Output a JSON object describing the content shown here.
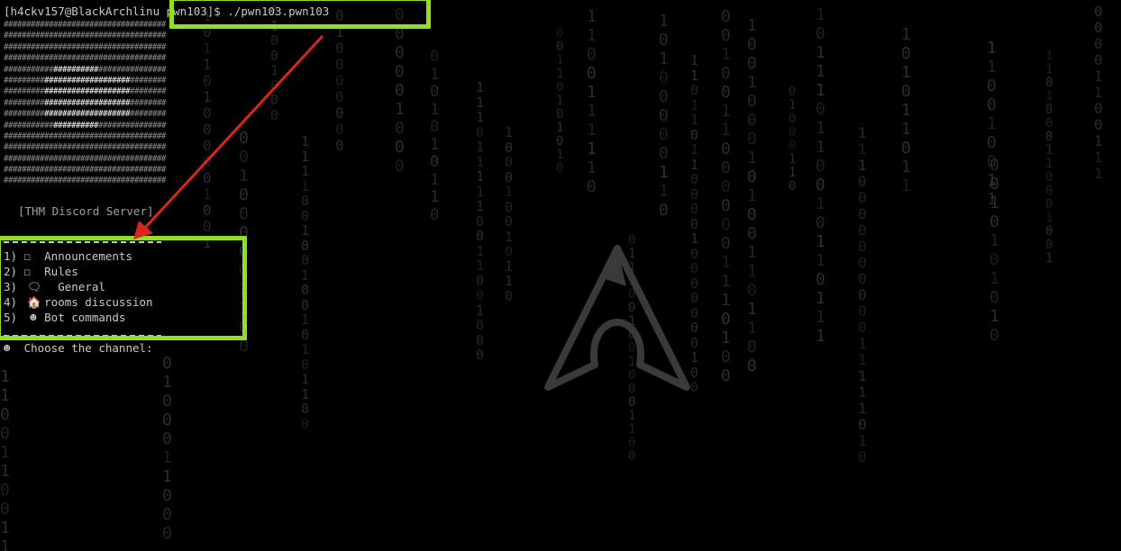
{
  "terminal": {
    "prompt_user": "[h4ckv157@BlackArchlinu",
    "prompt_dir": "pwn103]$ ./pwn103.pwn103",
    "server_label": "[THM Discord Server]",
    "menu": [
      {
        "label": "1) ☐  Announcements",
        "icon": "megaphone-icon"
      },
      {
        "label": "2) ☐  Rules",
        "icon": "rules-icon"
      },
      {
        "label": "3)      General",
        "icon": "speech-bubble-icon",
        "glyph": "🗨"
      },
      {
        "label": "4)    rooms discussion",
        "icon": "house-icon",
        "glyph": "🏠"
      },
      {
        "label": "5)    Bot commands",
        "icon": "robot-icon",
        "glyph": "☻"
      }
    ],
    "choose_prompt": "   Choose the channel:",
    "choose_glyph": "☻"
  },
  "colors": {
    "highlight": "#8ee020",
    "arrow": "#d9261c",
    "background": "#000000"
  }
}
